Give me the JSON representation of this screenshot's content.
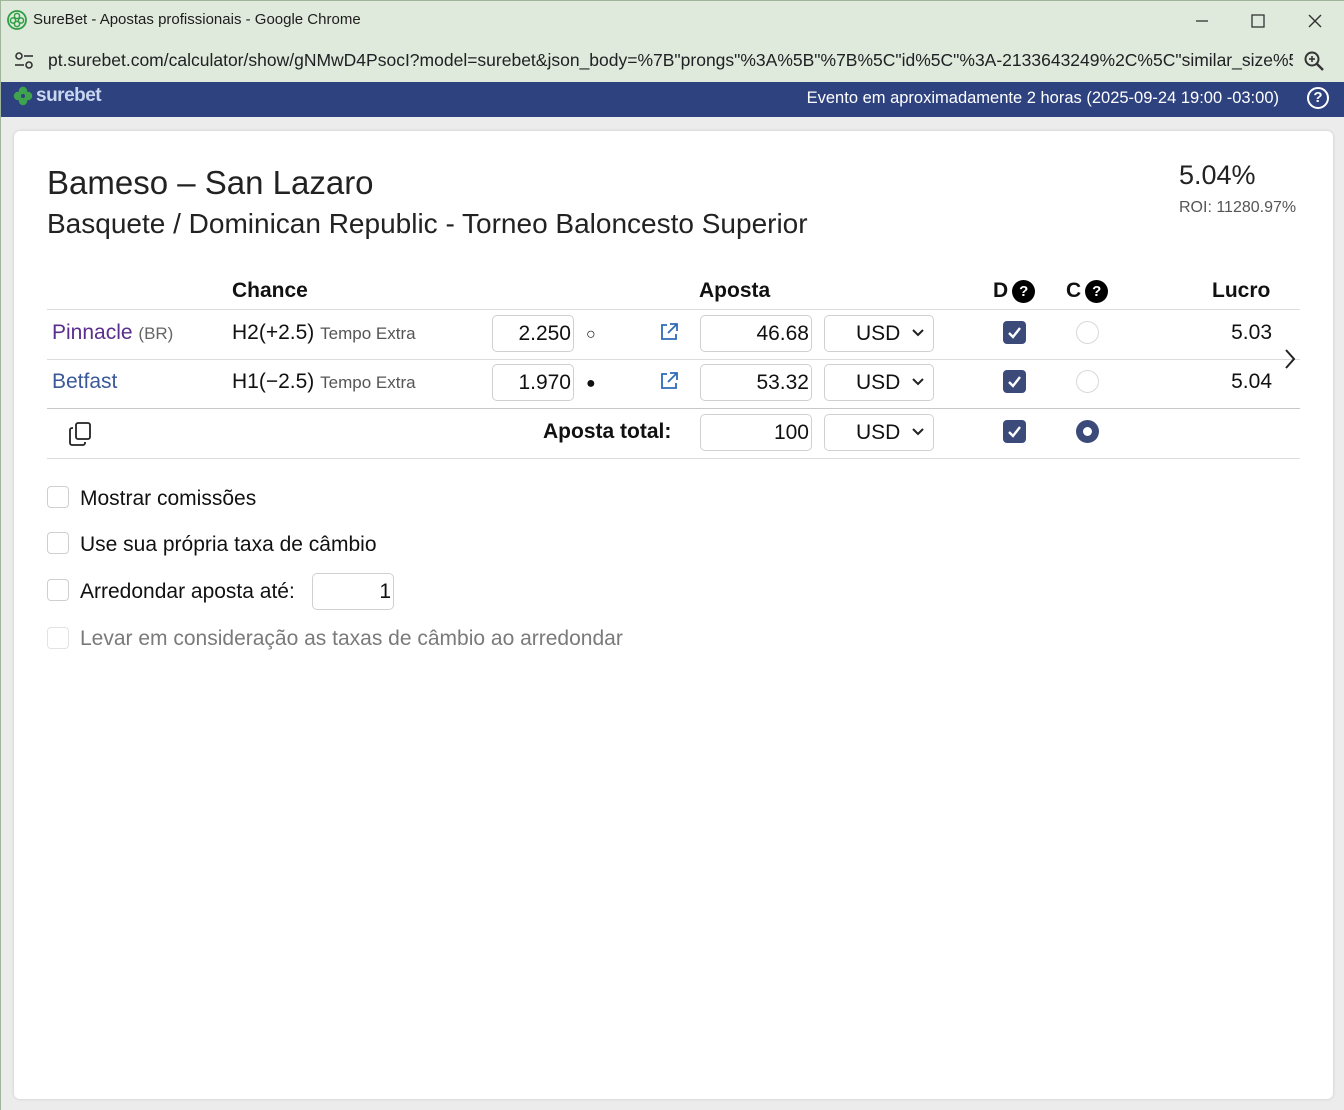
{
  "browser": {
    "window_title": "SureBet - Apostas profissionais - Google Chrome",
    "url": "pt.surebet.com/calculator/show/gNMwD4PsocI?model=surebet&json_body=%7B\"prongs\"%3A%5B\"%7B%5C\"id%5C\"%3A-2133643249%2C%5C\"similar_size%5..."
  },
  "header": {
    "logo_text": "surebet",
    "event_time": "Evento em aproximadamente 2 horas (2025-09-24 19:00 -03:00)",
    "help": "?"
  },
  "event": {
    "title": "Bameso – San Lazaro",
    "subtitle": "Basquete / Dominican Republic - Torneo Baloncesto Superior",
    "profit_percent": "5.04%",
    "roi": "ROI: 11280.97%"
  },
  "table": {
    "headers": {
      "chance": "Chance",
      "aposta": "Aposta",
      "d": "D",
      "c": "C",
      "lucro": "Lucro",
      "help": "?"
    },
    "rows": [
      {
        "bookmaker": "Pinnacle",
        "country": "(BR)",
        "market": "H2(+2.5)",
        "market_extra": "Tempo Extra",
        "odds": "2.250",
        "marker": "○",
        "stake": "46.68",
        "currency": "USD",
        "d_checked": true,
        "c_selected": false,
        "profit": "5.03"
      },
      {
        "bookmaker": "Betfast",
        "country": "",
        "market": "H1(−2.5)",
        "market_extra": "Tempo Extra",
        "odds": "1.970",
        "marker": "●",
        "stake": "53.32",
        "currency": "USD",
        "d_checked": true,
        "c_selected": false,
        "profit": "5.04"
      }
    ],
    "total": {
      "label": "Aposta total:",
      "stake": "100",
      "currency": "USD",
      "d_checked": true,
      "c_selected": true
    }
  },
  "options": {
    "show_commissions": "Mostrar comissões",
    "own_rate": "Use sua própria taxa de câmbio",
    "round_stake": "Arredondar aposta até:",
    "round_value": "1",
    "round_rates": "Levar em consideração as taxas de câmbio ao arredondar"
  },
  "colors": {
    "header_bg": "#2e4280",
    "accent": "#3b4a79",
    "pinnacle": "#5a2e8c",
    "betfast": "#3b5998"
  }
}
